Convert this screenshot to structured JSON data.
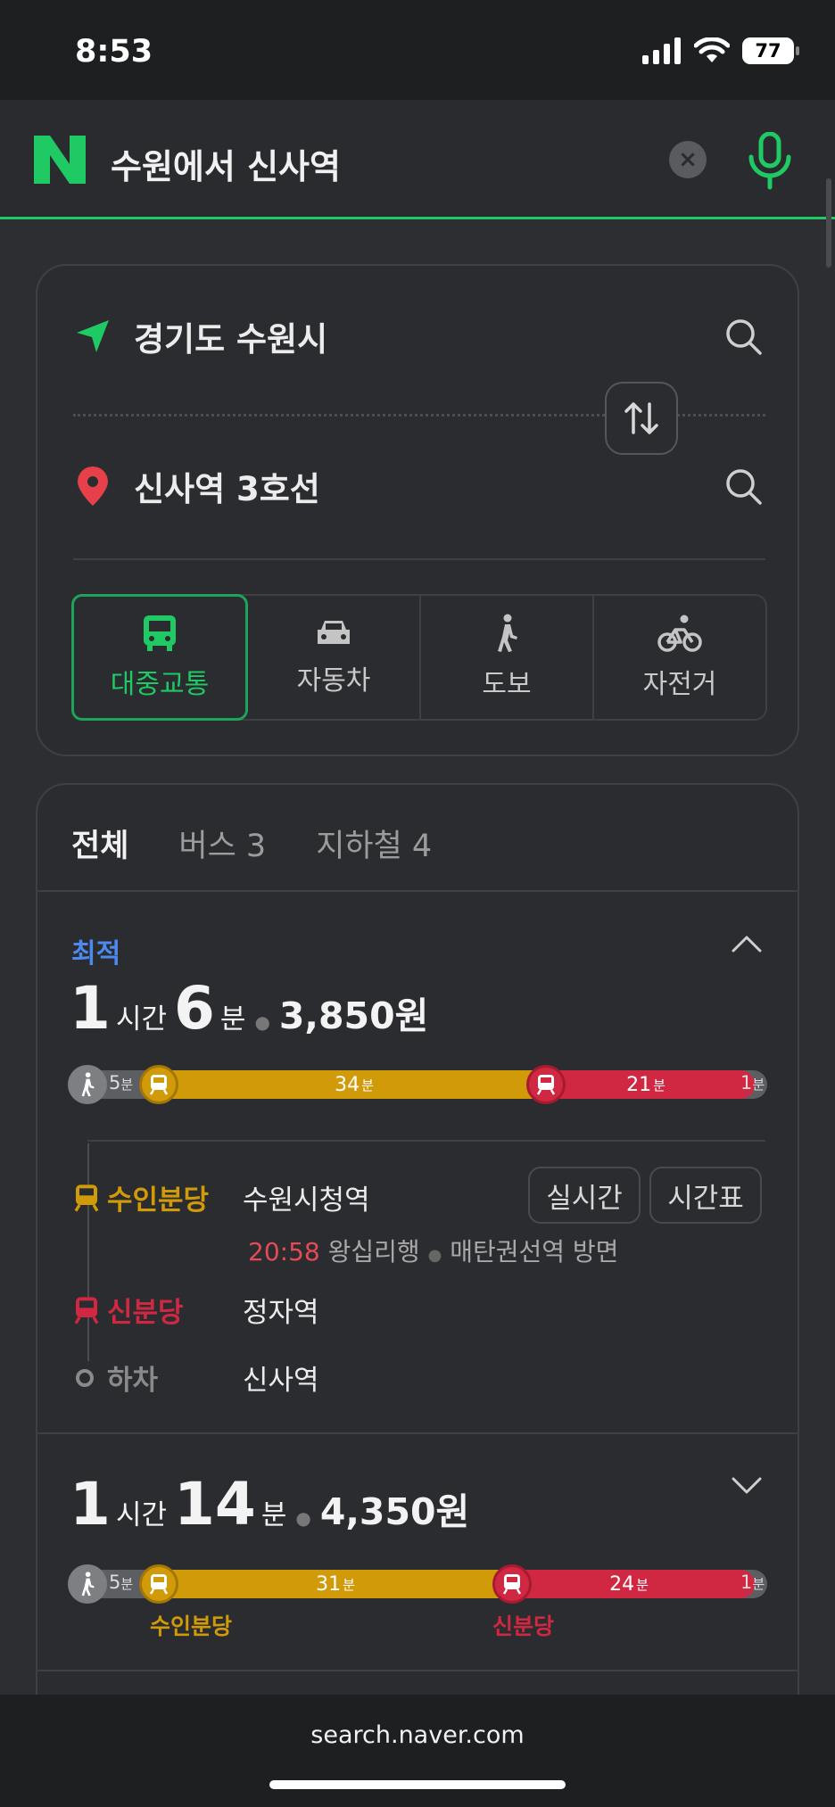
{
  "status_bar": {
    "time": "8:53",
    "battery": "77"
  },
  "search": {
    "query": "수원에서 신사역",
    "clear": "×"
  },
  "route": {
    "origin": "경기도 수원시",
    "destination": "신사역 3호선",
    "modes": [
      {
        "label": "대중교통",
        "icon": "bus-icon",
        "active": true
      },
      {
        "label": "자동차",
        "icon": "car-icon",
        "active": false
      },
      {
        "label": "도보",
        "icon": "walk-icon",
        "active": false
      },
      {
        "label": "자전거",
        "icon": "bicycle-icon",
        "active": false
      }
    ]
  },
  "results": {
    "tabs": [
      "전체",
      "버스 3",
      "지하철 4"
    ],
    "items": [
      {
        "badge": "최적",
        "hours": "1",
        "hours_unit": "시간",
        "minutes": "6",
        "minutes_unit": "분",
        "fare": "3,850원",
        "segments": {
          "walk1": "5",
          "yellow": "34",
          "red": "21",
          "walk2": "1",
          "unit": "분"
        },
        "steps": [
          {
            "line": "수인분당",
            "station": "수원시청역",
            "color": "#d09a08"
          },
          {
            "line": "신분당",
            "station": "정자역",
            "color": "#d02842"
          },
          {
            "line": "하차",
            "station": "신사역",
            "color": "#8a8a8a"
          }
        ],
        "realtime_label": "실시간",
        "timetable_label": "시간표",
        "next_time": "20:58",
        "next_desc": "왕십리행",
        "direction": "매탄권선역 방면"
      },
      {
        "hours": "1",
        "hours_unit": "시간",
        "minutes": "14",
        "minutes_unit": "분",
        "fare": "4,350원",
        "segments": {
          "walk1": "5",
          "yellow": "31",
          "red": "24",
          "walk2": "1",
          "unit": "분"
        },
        "line_labels": [
          "수인분당",
          "신분당"
        ]
      }
    ]
  },
  "browser": {
    "url": "search.naver.com"
  },
  "colors": {
    "accent": "#1fc963",
    "yellow_line": "#d09a08",
    "red_line": "#d02842",
    "best": "#4d8af0"
  }
}
